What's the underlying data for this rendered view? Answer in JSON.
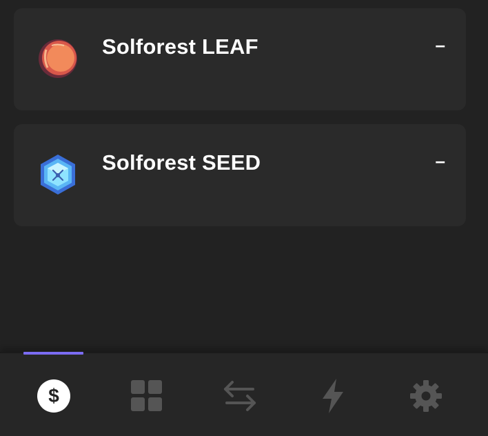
{
  "tokens": [
    {
      "name": "Solforest LEAF",
      "balance": "–",
      "icon": "leaf-coin-icon"
    },
    {
      "name": "Solforest SEED",
      "balance": "–",
      "icon": "seed-gem-icon"
    }
  ],
  "nav": {
    "items": [
      {
        "id": "balances",
        "icon": "dollar-icon",
        "active": true
      },
      {
        "id": "collectibles",
        "icon": "grid-icon",
        "active": false
      },
      {
        "id": "swap",
        "icon": "swap-arrows-icon",
        "active": false
      },
      {
        "id": "activity",
        "icon": "lightning-icon",
        "active": false
      },
      {
        "id": "settings",
        "icon": "gear-icon",
        "active": false
      }
    ]
  },
  "colors": {
    "background": "#222222",
    "card": "#2a2a2a",
    "accent": "#7b6cf2",
    "nav_inactive": "#555555"
  }
}
